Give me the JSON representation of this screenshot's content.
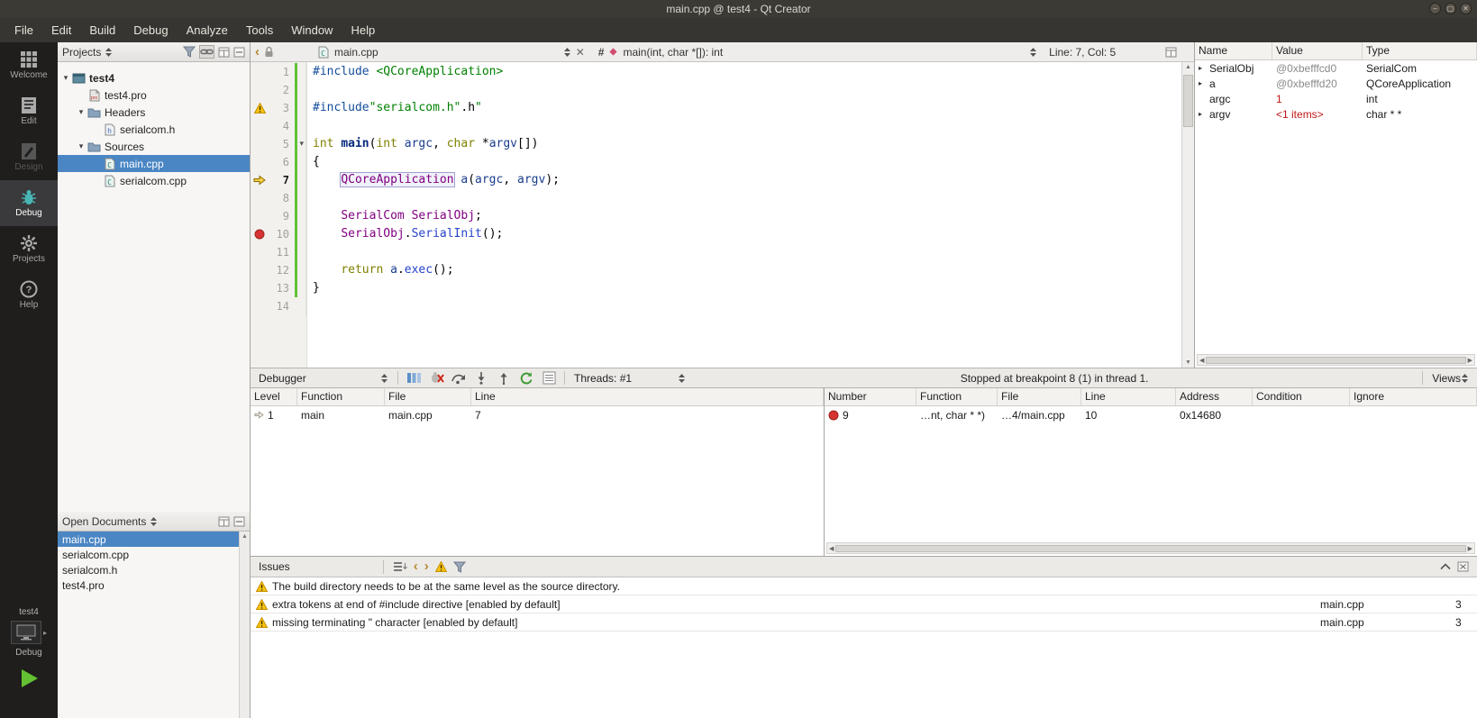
{
  "window": {
    "title": "main.cpp @ test4 - Qt Creator",
    "buttons": [
      "minimize",
      "maximize",
      "close"
    ]
  },
  "menu": {
    "items": [
      "File",
      "Edit",
      "Build",
      "Debug",
      "Analyze",
      "Tools",
      "Window",
      "Help"
    ]
  },
  "modes": {
    "items": [
      {
        "id": "welcome",
        "label": "Welcome"
      },
      {
        "id": "edit",
        "label": "Edit"
      },
      {
        "id": "design",
        "label": "Design",
        "disabled": true
      },
      {
        "id": "debug",
        "label": "Debug",
        "active": true
      },
      {
        "id": "projects",
        "label": "Projects"
      },
      {
        "id": "help",
        "label": "Help"
      }
    ],
    "bottom": {
      "project": "test4",
      "target": "Debug"
    }
  },
  "projects_panel": {
    "title": "Projects",
    "tree": [
      {
        "label": "test4",
        "depth": 0,
        "icon": "project-icon",
        "expanded": true,
        "bold": true
      },
      {
        "label": "test4.pro",
        "depth": 1,
        "icon": "profile-icon"
      },
      {
        "label": "Headers",
        "depth": 1,
        "icon": "folder-icon",
        "expanded": true
      },
      {
        "label": "serialcom.h",
        "depth": 2,
        "icon": "hfile-icon"
      },
      {
        "label": "Sources",
        "depth": 1,
        "icon": "folder-icon",
        "expanded": true
      },
      {
        "label": "main.cpp",
        "depth": 2,
        "icon": "cppfile-icon",
        "selected": true
      },
      {
        "label": "serialcom.cpp",
        "depth": 2,
        "icon": "cppfile-icon"
      }
    ]
  },
  "open_documents": {
    "title": "Open Documents",
    "items": [
      {
        "label": "main.cpp",
        "selected": true
      },
      {
        "label": "serialcom.cpp"
      },
      {
        "label": "serialcom.h"
      },
      {
        "label": "test4.pro"
      }
    ]
  },
  "editor": {
    "document": "main.cpp",
    "symbol": "main(int, char *[]): int",
    "cursor": "Line: 7, Col: 5",
    "lines": [
      {
        "n": 1,
        "changed": true,
        "tokens": [
          {
            "t": "#include ",
            "c": "pp"
          },
          {
            "t": "<QCoreApplication>",
            "c": "str"
          }
        ]
      },
      {
        "n": 2,
        "changed": true,
        "tokens": []
      },
      {
        "n": 3,
        "changed": true,
        "marker": "warning",
        "tokens": [
          {
            "t": "#include",
            "c": "pp"
          },
          {
            "t": "\"serialcom.h\"",
            "c": "str"
          },
          {
            "t": ".h",
            "c": "pl"
          },
          {
            "t": "\"",
            "c": "str"
          }
        ]
      },
      {
        "n": 4,
        "changed": true,
        "tokens": []
      },
      {
        "n": 5,
        "changed": true,
        "fold": true,
        "tokens": [
          {
            "t": "int ",
            "c": "kw"
          },
          {
            "t": "main",
            "c": "fnb"
          },
          {
            "t": "(",
            "c": "pl"
          },
          {
            "t": "int ",
            "c": "kw"
          },
          {
            "t": "argc",
            "c": "var"
          },
          {
            "t": ", ",
            "c": "pl"
          },
          {
            "t": "char ",
            "c": "kw"
          },
          {
            "t": "*",
            "c": "pl"
          },
          {
            "t": "argv",
            "c": "var"
          },
          {
            "t": "[])",
            "c": "pl"
          }
        ]
      },
      {
        "n": 6,
        "changed": true,
        "tokens": [
          {
            "t": "{",
            "c": "pl"
          }
        ]
      },
      {
        "n": 7,
        "changed": true,
        "marker": "arrow",
        "current": true,
        "tokens": [
          {
            "t": "    ",
            "c": "pl"
          },
          {
            "t": "QCoreApplication",
            "c": "type boxed"
          },
          {
            "t": " ",
            "c": "pl"
          },
          {
            "t": "a",
            "c": "var"
          },
          {
            "t": "(",
            "c": "pl"
          },
          {
            "t": "argc",
            "c": "var"
          },
          {
            "t": ", ",
            "c": "pl"
          },
          {
            "t": "argv",
            "c": "var"
          },
          {
            "t": ");",
            "c": "pl"
          }
        ]
      },
      {
        "n": 8,
        "changed": true,
        "tokens": []
      },
      {
        "n": 9,
        "changed": true,
        "tokens": [
          {
            "t": "    ",
            "c": "pl"
          },
          {
            "t": "SerialCom",
            "c": "type"
          },
          {
            "t": " ",
            "c": "pl"
          },
          {
            "t": "SerialObj",
            "c": "type"
          },
          {
            "t": ";",
            "c": "pl"
          }
        ]
      },
      {
        "n": 10,
        "changed": true,
        "marker": "breakpoint",
        "tokens": [
          {
            "t": "    ",
            "c": "pl"
          },
          {
            "t": "SerialObj",
            "c": "type"
          },
          {
            "t": ".",
            "c": "pl"
          },
          {
            "t": "SerialInit",
            "c": "fn"
          },
          {
            "t": "();",
            "c": "pl"
          }
        ]
      },
      {
        "n": 11,
        "changed": true,
        "tokens": []
      },
      {
        "n": 12,
        "changed": true,
        "tokens": [
          {
            "t": "    ",
            "c": "pl"
          },
          {
            "t": "return",
            "c": "kw"
          },
          {
            "t": " ",
            "c": "pl"
          },
          {
            "t": "a",
            "c": "var"
          },
          {
            "t": ".",
            "c": "pl"
          },
          {
            "t": "exec",
            "c": "fn"
          },
          {
            "t": "();",
            "c": "pl"
          }
        ]
      },
      {
        "n": 13,
        "changed": true,
        "tokens": [
          {
            "t": "}",
            "c": "pl"
          }
        ]
      },
      {
        "n": 14,
        "tokens": []
      }
    ]
  },
  "debugger_bar": {
    "label": "Debugger",
    "threads": "Threads: #1",
    "status": "Stopped at breakpoint 8 (1) in thread 1.",
    "views": "Views"
  },
  "stack": {
    "headers": [
      "Level",
      "Function",
      "File",
      "Line"
    ],
    "rows": [
      {
        "level": "1",
        "function": "main",
        "file": "main.cpp",
        "line": "7",
        "current": true
      }
    ]
  },
  "breakpoints": {
    "headers": [
      "Number",
      "Function",
      "File",
      "Line",
      "Address",
      "Condition",
      "Ignore"
    ],
    "rows": [
      {
        "number": "9",
        "function": "…nt, char * *)",
        "file": "…4/main.cpp",
        "line": "10",
        "address": "0x14680",
        "condition": "",
        "ignore": ""
      }
    ]
  },
  "locals": {
    "headers": [
      "Name",
      "Value",
      "Type"
    ],
    "rows": [
      {
        "name": "SerialObj",
        "value": "@0xbefffcd0",
        "type": "SerialCom",
        "expandable": true,
        "value_style": "address"
      },
      {
        "name": "a",
        "value": "@0xbefffd20",
        "type": "QCoreApplication",
        "expandable": true,
        "value_style": "address"
      },
      {
        "name": "argc",
        "value": "1",
        "type": "int",
        "expandable": false,
        "value_style": "changed"
      },
      {
        "name": "argv",
        "value": "<1 items>",
        "type": "char * *",
        "expandable": true,
        "value_style": "changed"
      }
    ]
  },
  "issues": {
    "title": "Issues",
    "rows": [
      {
        "text": "The build directory needs to be at the same level as the source directory.",
        "file": "",
        "line": ""
      },
      {
        "text": "extra tokens at end of #include directive [enabled by default]",
        "file": "main.cpp",
        "line": "3"
      },
      {
        "text": "missing terminating \" character [enabled by default]",
        "file": "main.cpp",
        "line": "3"
      }
    ]
  },
  "colors": {
    "selection_blue": "#4a86c4",
    "breakpoint_red": "#d63333",
    "current_line_arrow_yellow": "#f7cf46",
    "warning_yellow": "#f5c211",
    "run_green": "#63c132"
  }
}
